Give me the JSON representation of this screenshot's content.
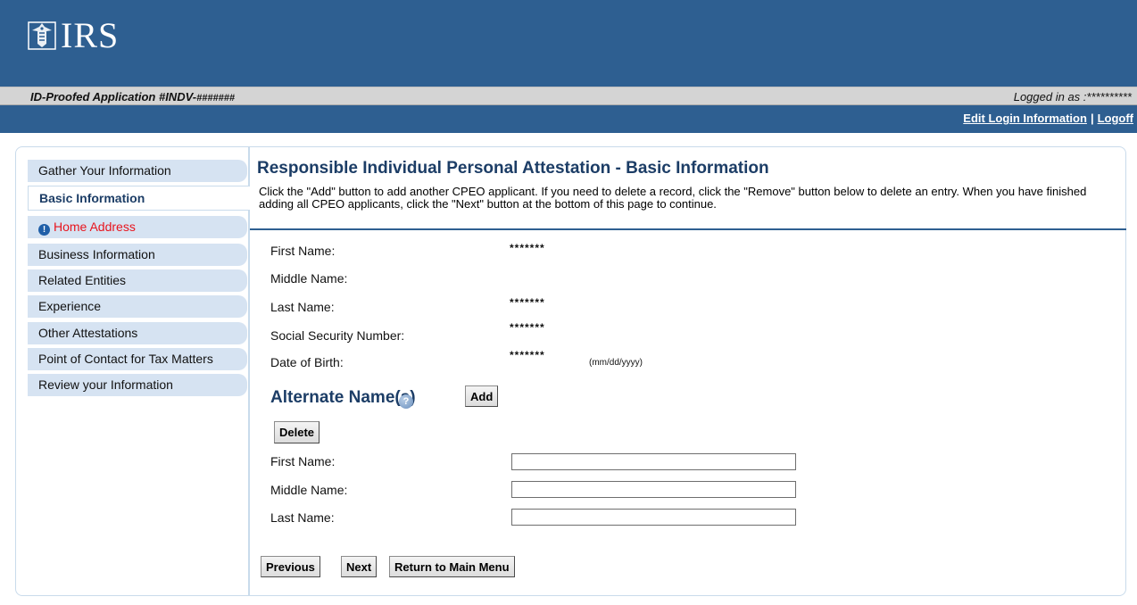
{
  "header": {
    "logo_text": "IRS",
    "app_id_prefix": "ID-Proofed Application #INDV-",
    "app_id_masked": "#######",
    "logged_in": "Logged in as :**********",
    "links": {
      "edit_login": "Edit Login Information",
      "separator": "|",
      "logoff": "Logoff"
    },
    "colors": {
      "brand": "#2e5f91",
      "bar": "#d4d4d4"
    }
  },
  "sidebar": {
    "items": [
      {
        "label": "Gather Your Information"
      },
      {
        "label": "Basic Information",
        "active": true
      },
      {
        "label": "Home Address",
        "alert": true,
        "icon": "info-icon"
      },
      {
        "label": "Business Information"
      },
      {
        "label": "Related Entities"
      },
      {
        "label": "Experience"
      },
      {
        "label": "Other Attestations"
      },
      {
        "label": "Point of Contact for Tax Matters"
      },
      {
        "label": "Review your Information"
      }
    ]
  },
  "main": {
    "title": "Responsible Individual Personal Attestation - Basic Information",
    "instructions": "Click the \"Add\" button to add another CPEO applicant. If you need to delete a record, click the \"Remove\" button below to delete an entry. When you have finished adding all CPEO applicants, click the \"Next\" button at the bottom of this page to continue.",
    "fields": {
      "first_name": {
        "label": "First Name:",
        "value": "*******"
      },
      "middle_name": {
        "label": "Middle Name:",
        "value": ""
      },
      "last_name": {
        "label": "Last Name:",
        "value": "*******"
      },
      "ssn": {
        "label": "Social Security Number:",
        "value": "*******"
      },
      "dob": {
        "label": "Date of Birth:",
        "value": "*******",
        "hint": "(mm/dd/yyyy)"
      }
    },
    "alternate": {
      "title": "Alternate Name(s)",
      "help_icon": "help-icon",
      "add_label": "Add",
      "delete_label": "Delete",
      "first_name_label": "First Name:",
      "middle_name_label": "Middle Name:",
      "last_name_label": "Last Name:",
      "first_name_value": "",
      "middle_name_value": "",
      "last_name_value": ""
    },
    "buttons": {
      "previous": "Previous",
      "next": "Next",
      "return": "Return to Main Menu"
    }
  }
}
